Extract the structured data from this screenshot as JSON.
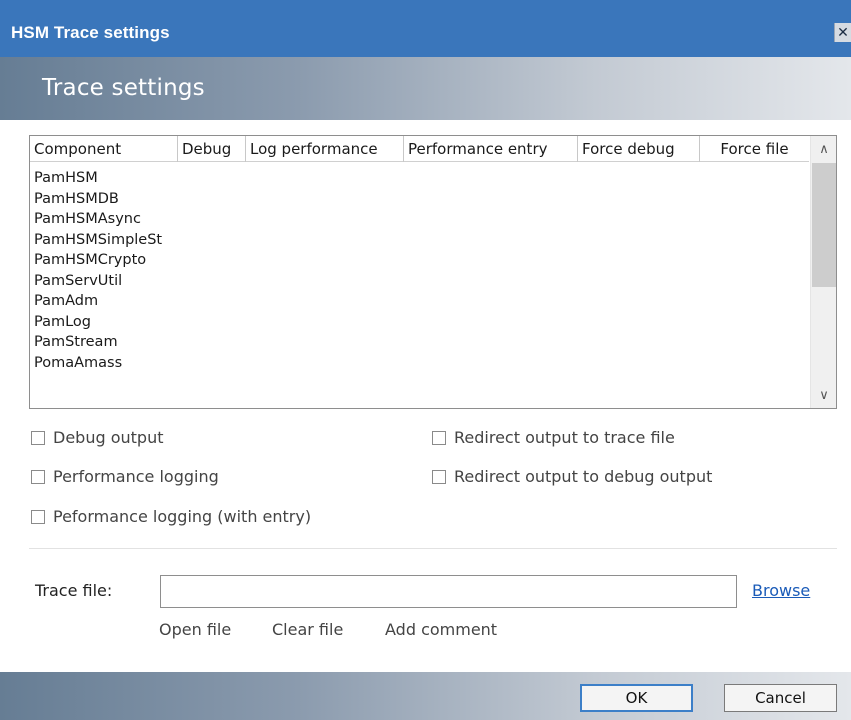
{
  "window": {
    "title": "HSM Trace settings",
    "close_glyph": "✕"
  },
  "header": {
    "title": "Trace settings"
  },
  "grid": {
    "columns": [
      "Component",
      "Debug",
      "Log performance",
      "Performance entry",
      "Force debug",
      "Force file"
    ],
    "rows": [
      "PamHSM",
      "PamHSMDB",
      "PamHSMAsync",
      "PamHSMSimpleSt",
      "PamHSMCrypto",
      "PamServUtil",
      "PamAdm",
      "PamLog",
      "PamStream",
      "PomaAmass"
    ],
    "scroll_up_glyph": "∧",
    "scroll_down_glyph": "∨"
  },
  "options": {
    "debug_output": {
      "label": "Debug output",
      "checked": false
    },
    "performance_logging": {
      "label": "Performance logging",
      "checked": false
    },
    "performance_logging_entry": {
      "label": "Peformance logging (with entry)",
      "checked": false
    },
    "redirect_trace_file": {
      "label": "Redirect output to trace file",
      "checked": false
    },
    "redirect_debug_output": {
      "label": "Redirect output to debug output",
      "checked": false
    }
  },
  "trace_file": {
    "label": "Trace file:",
    "value": "",
    "browse_label": "Browse"
  },
  "actions": {
    "open_file": "Open file",
    "clear_file": "Clear file",
    "add_comment": "Add comment"
  },
  "buttons": {
    "ok": "OK",
    "cancel": "Cancel"
  }
}
